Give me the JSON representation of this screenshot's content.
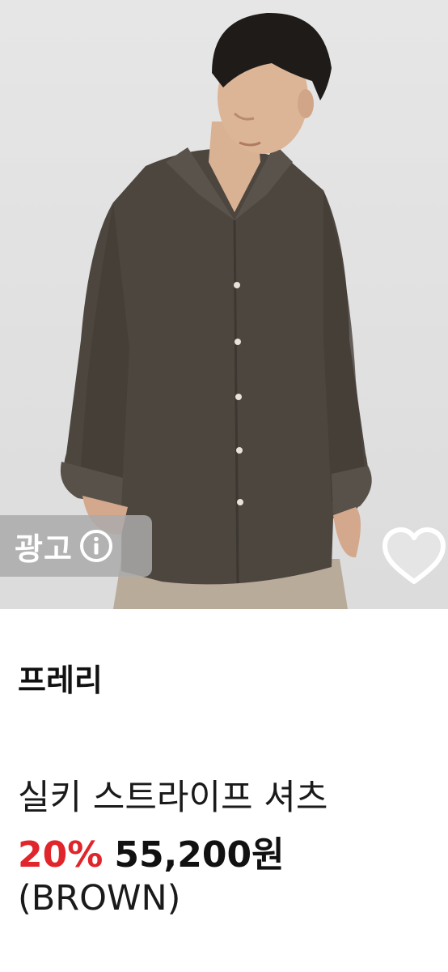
{
  "product": {
    "ad_label": "광고",
    "brand": "프레리",
    "title_line1": "실키 스트라이프 셔츠",
    "title_line2": "(BROWN)",
    "discount": "20%",
    "price": "55,200원"
  },
  "icons": {
    "ad_info": "info-icon",
    "wishlist": "heart-outline-icon"
  },
  "colors": {
    "discount": "#e0252b",
    "text": "#111111"
  }
}
